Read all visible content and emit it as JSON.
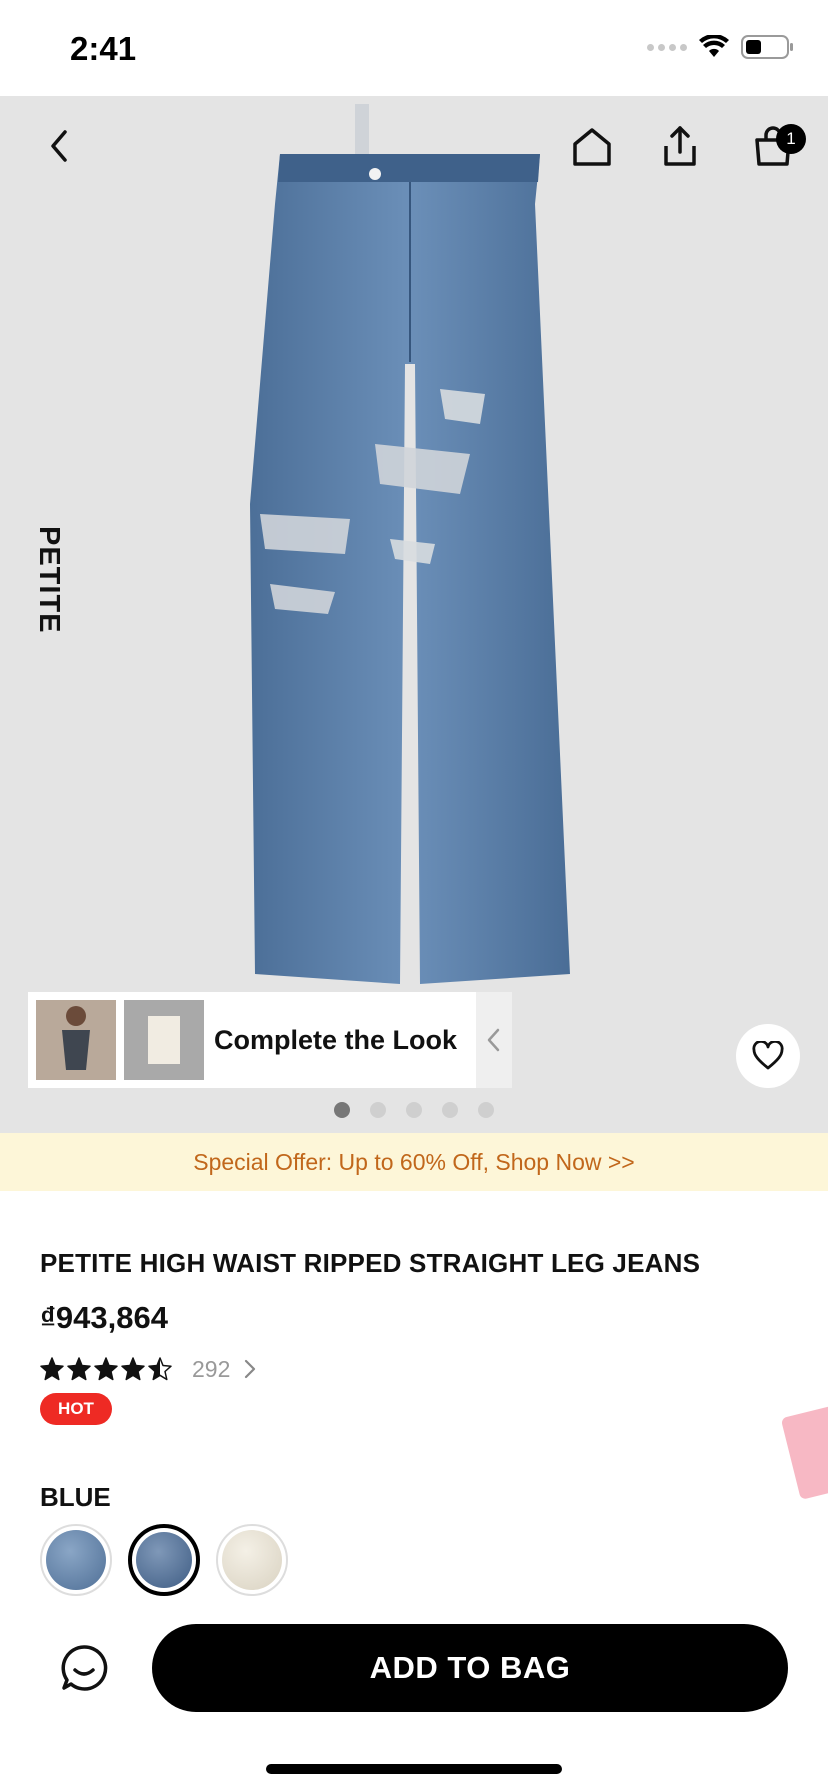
{
  "status_bar": {
    "time": "2:41"
  },
  "header": {
    "cart_count": "1",
    "icons": [
      "back-icon",
      "home-icon",
      "share-icon",
      "bag-icon"
    ]
  },
  "gallery": {
    "side_label": "PETITE",
    "complete_the_look": "Complete the Look",
    "total_images": 5,
    "current_image": 1
  },
  "promo": {
    "text": "Special Offer: Up to 60% Off, Shop Now >>"
  },
  "product": {
    "title": "PETITE HIGH WAIST RIPPED STRAIGHT LEG JEANS",
    "price": "₫943,864",
    "rating": 4.5,
    "review_count": "292",
    "badge": "HOT"
  },
  "color": {
    "selected_label": "BLUE",
    "swatches": [
      "light-blue-denim",
      "blue-denim",
      "cream"
    ],
    "selected_index": 1
  },
  "actions": {
    "add_to_bag": "ADD TO BAG"
  },
  "colors": {
    "promo_bg": "#fdf6d8",
    "promo_text": "#c1671b",
    "hot_badge": "#ee2a24",
    "primary_button": "#000000"
  }
}
